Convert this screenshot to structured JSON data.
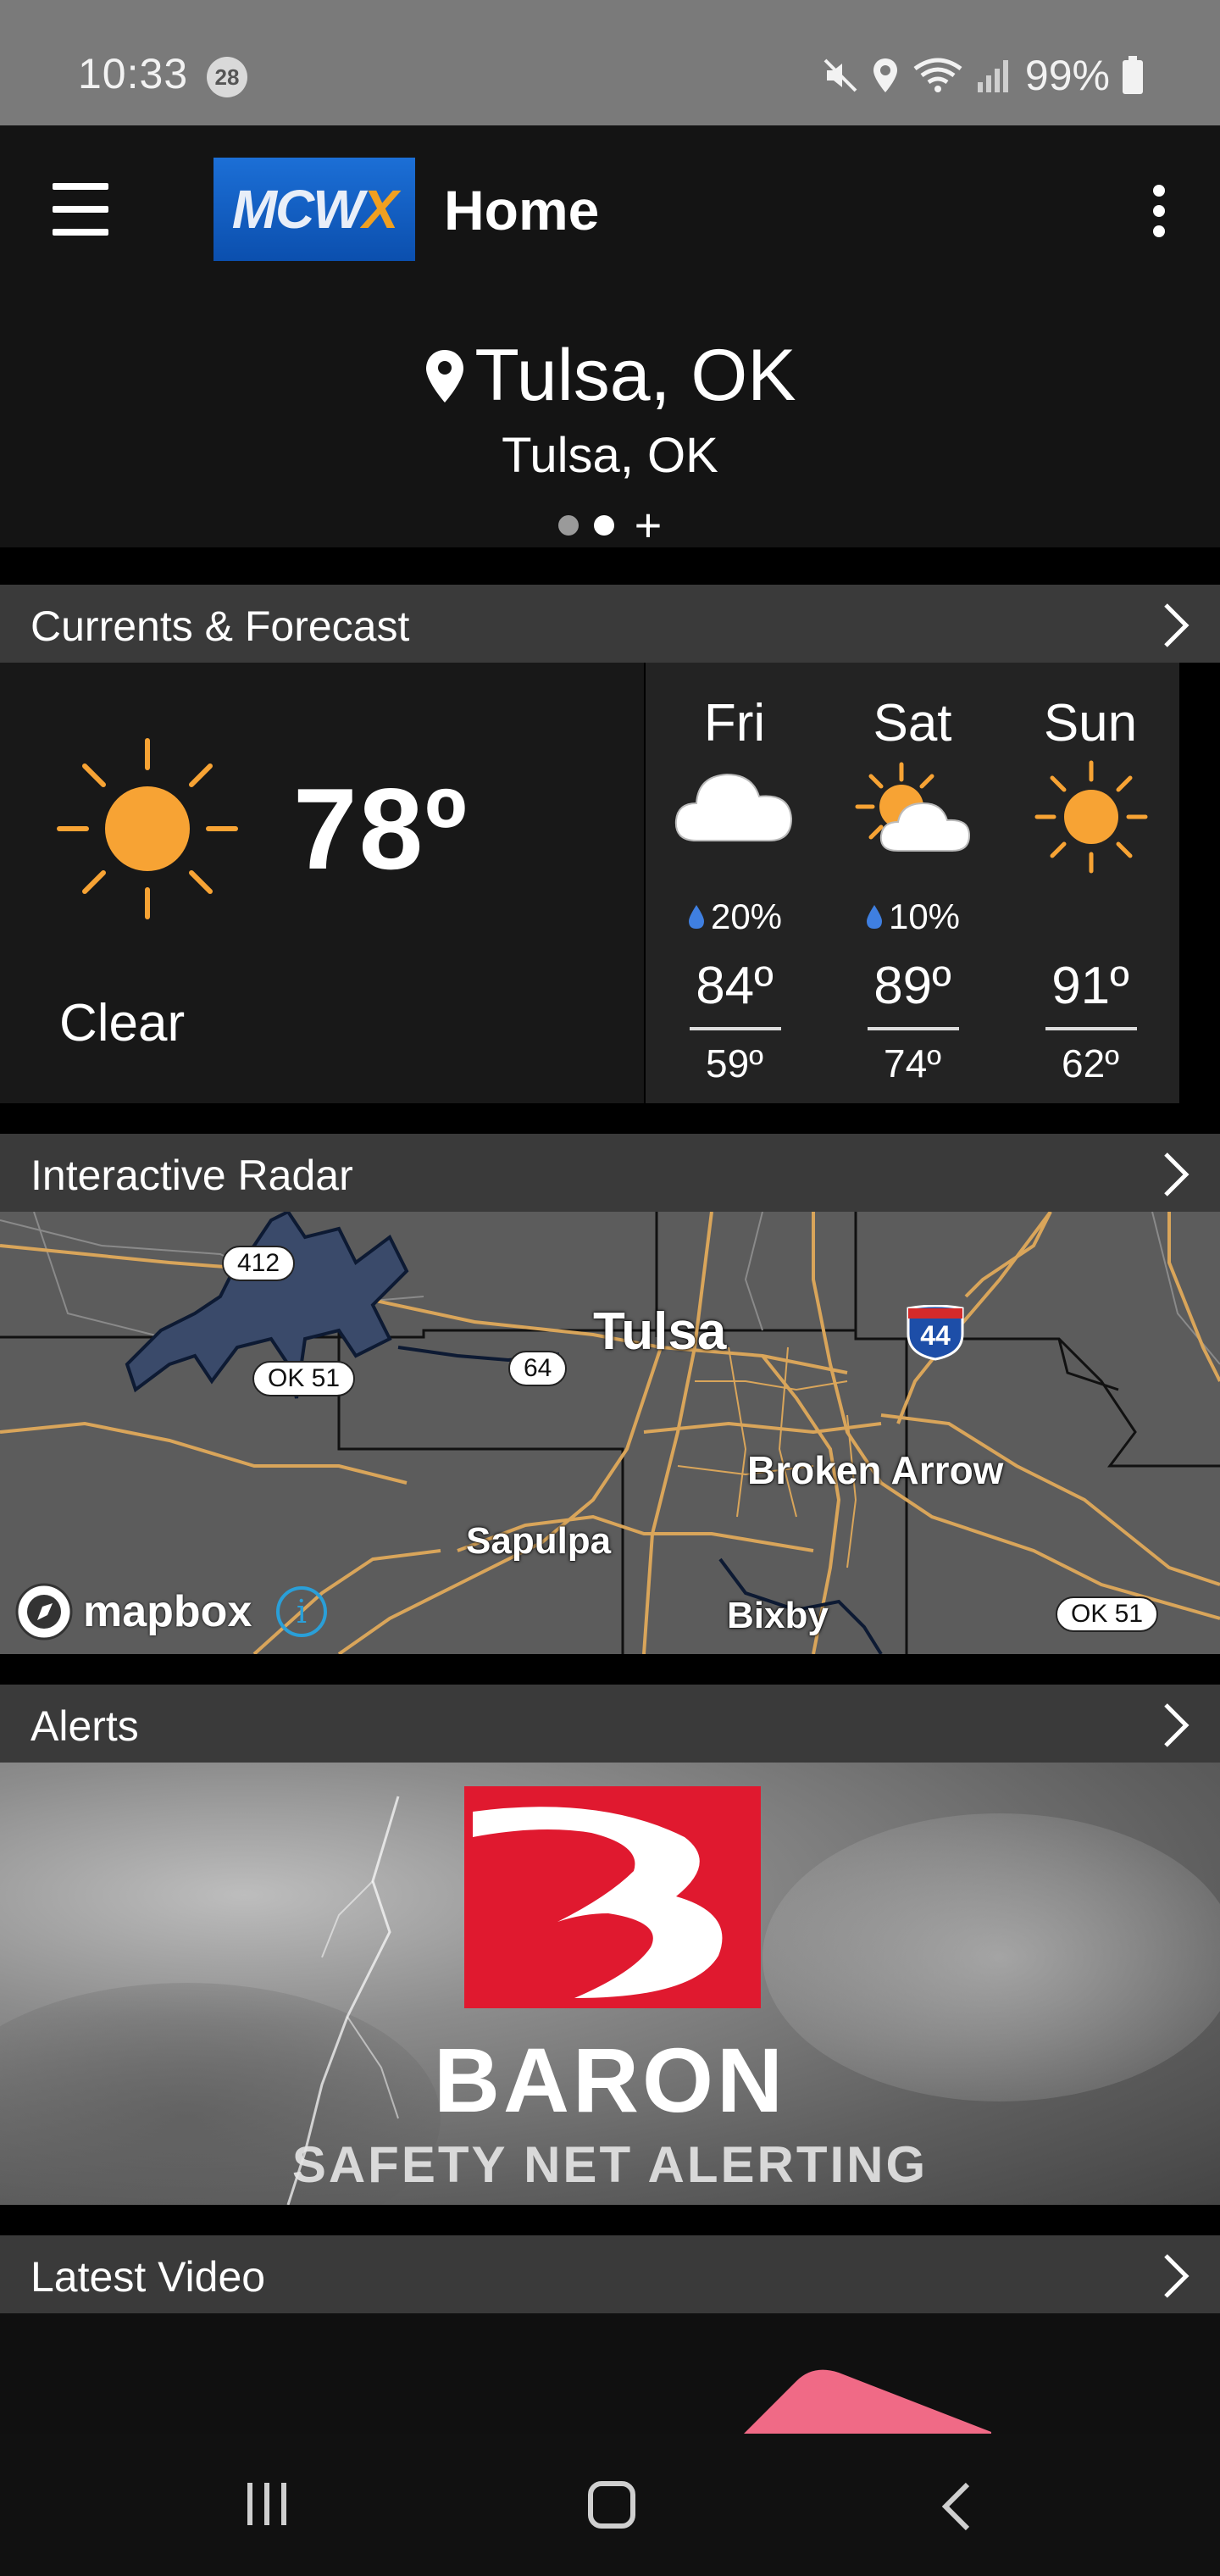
{
  "status_bar": {
    "time": "10:33",
    "notification_count": "28",
    "battery": "99%",
    "icons": [
      "mute-icon",
      "location-icon",
      "wifi-icon",
      "signal-icon",
      "battery-icon"
    ]
  },
  "app_bar": {
    "menu_icon": "hamburger-menu-icon",
    "logo_text_main": "MCW",
    "logo_text_accent": "X",
    "title": "Home",
    "more_icon": "more-vertical-icon"
  },
  "location": {
    "name": "Tulsa, OK",
    "subtitle": "Tulsa, OK",
    "pager": {
      "pages": 2,
      "active_index": 1,
      "add_label": "+"
    }
  },
  "sections": {
    "currents": "Currents & Forecast",
    "radar": "Interactive Radar",
    "alerts": "Alerts",
    "video": "Latest Video"
  },
  "current": {
    "temp": "78º",
    "condition": "Clear",
    "icon": "sun-icon"
  },
  "forecast": [
    {
      "day": "Fri",
      "icon": "cloud-icon",
      "precip": "20%",
      "hi": "84º",
      "lo": "59º"
    },
    {
      "day": "Sat",
      "icon": "partly-cloudy-icon",
      "precip": "10%",
      "hi": "89º",
      "lo": "74º"
    },
    {
      "day": "Sun",
      "icon": "sun-icon",
      "precip": "",
      "hi": "91º",
      "lo": "62º"
    }
  ],
  "radar_map": {
    "cities": {
      "tulsa": "Tulsa",
      "broken_arrow": "Broken Arrow",
      "sapulpa": "Sapulpa",
      "bixby": "Bixby"
    },
    "shields": {
      "us412": "412",
      "ok51_west": "OK 51",
      "us64": "64",
      "i44": "44",
      "ok51_east": "OK 51"
    },
    "attribution": "mapbox",
    "info_label": "i"
  },
  "alerts_banner": {
    "brand": "BARON",
    "tagline": "SAFETY NET ALERTING"
  },
  "colors": {
    "status_bar": "#7a7a7a",
    "app_bar": "#141414",
    "section_header": "#3a3a3a",
    "sun": "#f7a334",
    "rain_drop": "#3f7fe0",
    "baron_red": "#e0192f",
    "map_roads": "#d9a55a"
  }
}
